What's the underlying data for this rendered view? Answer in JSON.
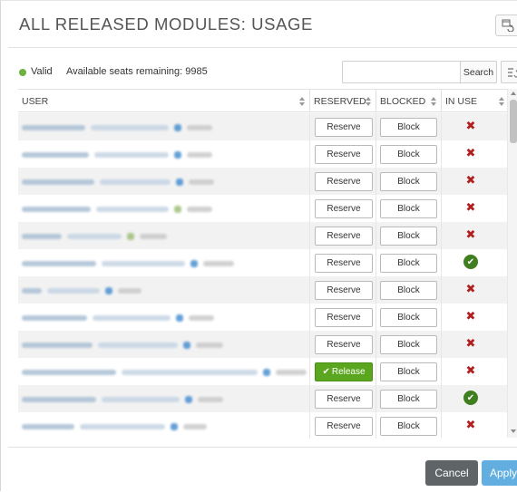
{
  "header": {
    "title": "ALL RELEASED MODULES: USAGE",
    "refresh_icon": "refresh-window-icon"
  },
  "status": {
    "indicator_color": "#6cb33e",
    "valid_label": "Valid",
    "seats_label": "Available seats remaining: 9985"
  },
  "search": {
    "value": "",
    "placeholder": "",
    "button_label": "Search",
    "filter_icon": "filter-columns-icon"
  },
  "table": {
    "columns": [
      "USER",
      "RESERVED",
      "BLOCKED",
      "IN USE"
    ],
    "rows": [
      {
        "reserved_label": "Reserve",
        "reserved_state": "reserve",
        "blocked_label": "Block",
        "in_use": false
      },
      {
        "reserved_label": "Reserve",
        "reserved_state": "reserve",
        "blocked_label": "Block",
        "in_use": false
      },
      {
        "reserved_label": "Reserve",
        "reserved_state": "reserve",
        "blocked_label": "Block",
        "in_use": false
      },
      {
        "reserved_label": "Reserve",
        "reserved_state": "reserve",
        "blocked_label": "Block",
        "in_use": false
      },
      {
        "reserved_label": "Reserve",
        "reserved_state": "reserve",
        "blocked_label": "Block",
        "in_use": false
      },
      {
        "reserved_label": "Reserve",
        "reserved_state": "reserve",
        "blocked_label": "Block",
        "in_use": true
      },
      {
        "reserved_label": "Reserve",
        "reserved_state": "reserve",
        "blocked_label": "Block",
        "in_use": false
      },
      {
        "reserved_label": "Reserve",
        "reserved_state": "reserve",
        "blocked_label": "Block",
        "in_use": false
      },
      {
        "reserved_label": "Reserve",
        "reserved_state": "reserve",
        "blocked_label": "Block",
        "in_use": false
      },
      {
        "reserved_label": "Release",
        "reserved_state": "release",
        "blocked_label": "Block",
        "in_use": false
      },
      {
        "reserved_label": "Reserve",
        "reserved_state": "reserve",
        "blocked_label": "Block",
        "in_use": true
      },
      {
        "reserved_label": "Reserve",
        "reserved_state": "reserve",
        "blocked_label": "Block",
        "in_use": false
      }
    ]
  },
  "footer": {
    "cancel_label": "Cancel",
    "apply_label": "Apply"
  },
  "colors": {
    "release_green": "#5aa61f",
    "in_use_yes": "#3f7f1f",
    "in_use_no": "#b11f1f",
    "apply_blue": "#62aee0",
    "cancel_grey": "#5f6466"
  }
}
